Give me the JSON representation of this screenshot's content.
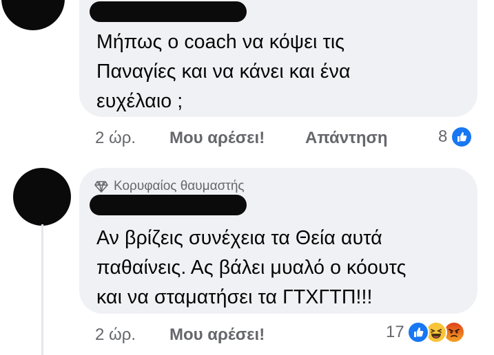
{
  "comments": [
    {
      "text_lines": [
        "Μήπως ο coach να κόψει τις",
        "Παναγίες και να κάνει και ένα",
        "ευχέλαιο ;"
      ],
      "time": "2 ώρ.",
      "like_label": "Μου αρέσει!",
      "reply_label": "Απάντηση",
      "reaction_count": "8",
      "reaction_icons": [
        "like-icon"
      ]
    },
    {
      "badge_label": "Κορυφαίος θαυμαστής",
      "badge_icon": "diamond-icon",
      "text_lines": [
        "Αν βρίζεις συνέχεια τα Θεία αυτά",
        "παθαίνεις. Ας βάλει μυαλό ο κόουτς",
        "και να σταματήσει τα ΓΤΧΓΤΠ!!!"
      ],
      "time": "2 ώρ.",
      "like_label": "Μου αρέσει!",
      "reaction_count": "17",
      "reaction_icons": [
        "like-icon",
        "haha-icon",
        "angry-icon"
      ]
    }
  ],
  "colors": {
    "bubble": "#eff1f4",
    "meta_text": "#65676b",
    "like_blue": "#1877f2",
    "haha_yellow": "#f7c43a",
    "angry_red": "#e9710f"
  }
}
